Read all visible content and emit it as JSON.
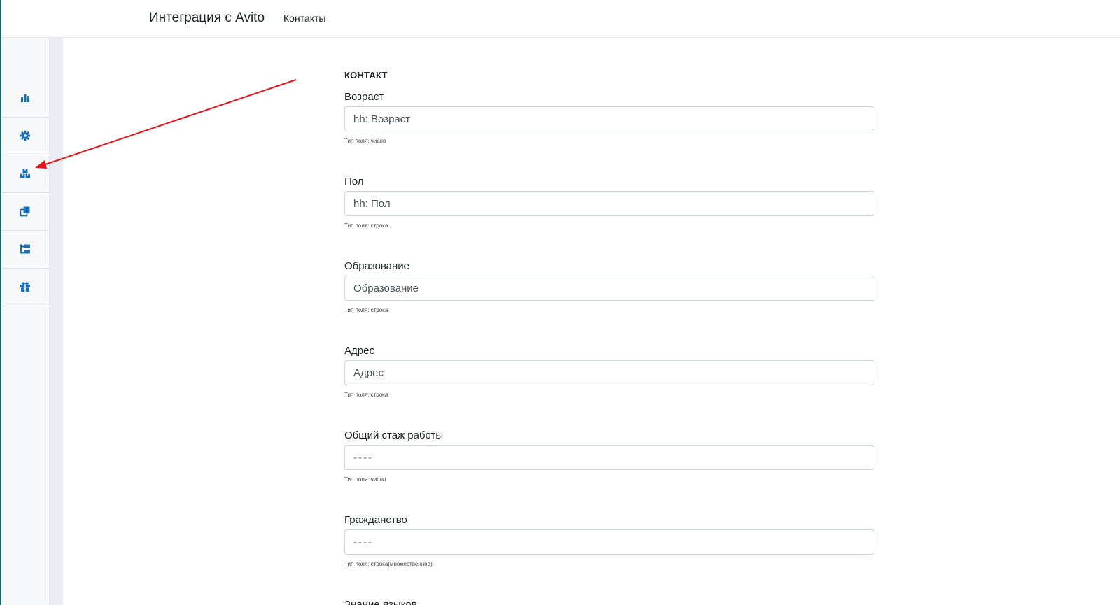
{
  "header": {
    "brand": "Интеграция с Avito",
    "nav_link": "Контакты"
  },
  "sidebar": {
    "items": [
      {
        "icon": "bar-chart-icon"
      },
      {
        "icon": "gear-icon"
      },
      {
        "icon": "boxes-icon"
      },
      {
        "icon": "clone-icon"
      },
      {
        "icon": "tree-icon"
      },
      {
        "icon": "gift-icon"
      }
    ],
    "accent_color": "#1a6fb5"
  },
  "annotation": {
    "arrow_color": "#e8121a",
    "points_to": "boxes-icon"
  },
  "form": {
    "section_title": "КОНТАКТ",
    "fields": [
      {
        "label": "Возраст",
        "value": "hh: Возраст",
        "placeholder": "",
        "hint": "Тип поля: число"
      },
      {
        "label": "Пол",
        "value": "hh: Пол",
        "placeholder": "",
        "hint": "Тип поля: строка"
      },
      {
        "label": "Образование",
        "value": "Образование",
        "placeholder": "",
        "hint": "Тип поля: строка"
      },
      {
        "label": "Адрес",
        "value": "Адрес",
        "placeholder": "",
        "hint": "Тип поля: строка"
      },
      {
        "label": "Общий стаж работы",
        "value": "",
        "placeholder": "----",
        "hint": "Тип поля: число"
      },
      {
        "label": "Гражданство",
        "value": "",
        "placeholder": "----",
        "hint": "Тип поля: строка(множественное)"
      },
      {
        "label": "Знание языков",
        "value": "",
        "placeholder": "",
        "hint": ""
      }
    ]
  }
}
